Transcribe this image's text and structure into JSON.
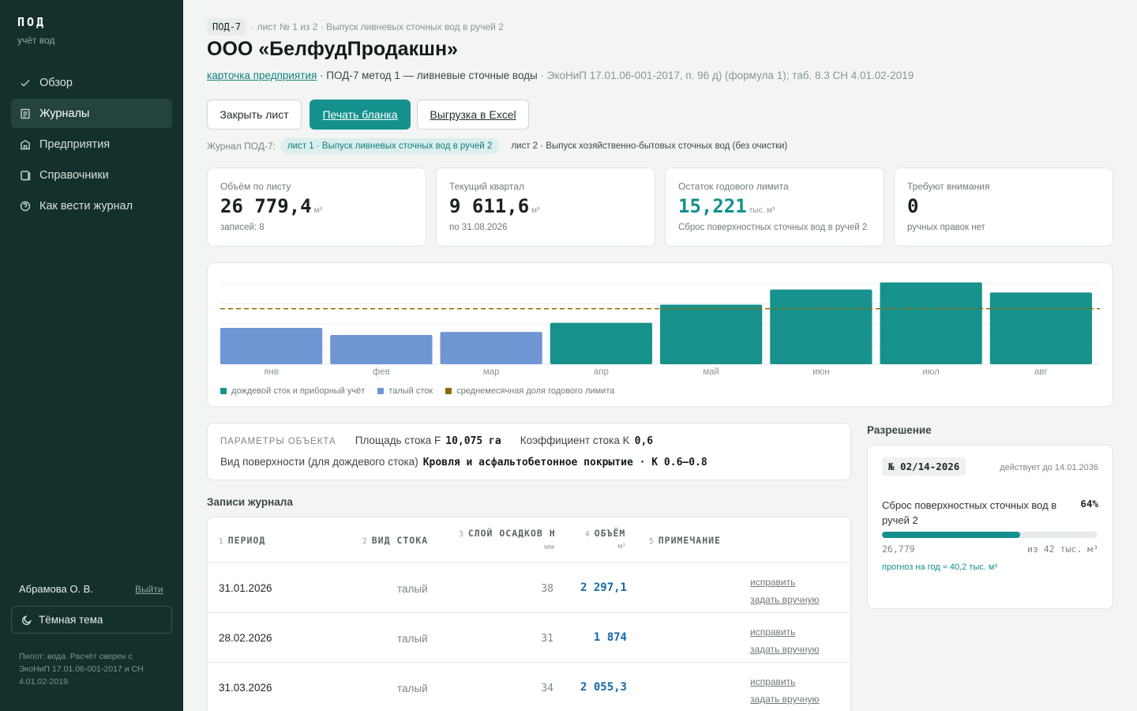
{
  "sidebar": {
    "brand": "ПОД",
    "brand_sub": "учёт вод",
    "nav": [
      {
        "label": "Обзор",
        "icon": "check-icon",
        "active": false
      },
      {
        "label": "Журналы",
        "icon": "journal-icon",
        "active": true
      },
      {
        "label": "Предприятия",
        "icon": "building-icon",
        "active": false
      },
      {
        "label": "Справочники",
        "icon": "book-icon",
        "active": false
      },
      {
        "label": "Как вести журнал",
        "icon": "help-icon",
        "active": false
      }
    ],
    "user": "Абрамова О. В.",
    "logout": "Выйти",
    "theme_toggle": "Тёмная тема",
    "footnote": "Пилот: вода. Расчёт сверен с ЭкоНиП 17.01.06-001-2017 и СН 4.01.02-2019."
  },
  "header": {
    "form_code": "ПОД-7",
    "crumb": "· лист № 1 из 2 · Выпуск ливневых сточных вод в ручей 2",
    "title": "ООО «БелфудПродакшн»",
    "card_link": "карточка предприятия",
    "method": " · ПОД-7 метод 1 — ливневые сточные воды",
    "reference": " · ЭкоНиП 17.01.06-001-2017, п. 96 д) (формула 1); таб. 8.3 СН 4.01.02-2019"
  },
  "actions": {
    "close": "Закрыть лист",
    "print": "Печать бланка",
    "export": "Выгрузка в Excel"
  },
  "sheets": {
    "label": "Журнал ПОД-7:",
    "tabs": [
      {
        "label": "лист 1 · Выпуск ливневых сточных вод в ручей 2",
        "active": true
      },
      {
        "label": "лист 2 · Выпуск хозяйственно-бытовых сточных вод (без очистки)",
        "active": false
      }
    ]
  },
  "stats": [
    {
      "label": "Объём по листу",
      "value": "26 779,4",
      "unit": "м³",
      "sub": "записей: 8",
      "accent": false
    },
    {
      "label": "Текущий квартал",
      "value": "9 611,6",
      "unit": "м³",
      "sub": "по 31.08.2026",
      "accent": false
    },
    {
      "label": "Остаток годового лимита",
      "value": "15,221",
      "unit": "тыс. м³",
      "sub": "Сброс поверхностных сточных вод в ручей 2",
      "accent": true
    },
    {
      "label": "Требуют внимания",
      "value": "0",
      "unit": "",
      "sub": "ручных правок нет",
      "accent": false
    }
  ],
  "chart_data": {
    "type": "bar",
    "categories": [
      "янв",
      "фев",
      "мар",
      "апр",
      "май",
      "июн",
      "июл",
      "авг"
    ],
    "series": [
      {
        "name": "дождевой сток и приборный учёт",
        "values": [
          null,
          null,
          null,
          2.05,
          2.95,
          3.7,
          4.05,
          3.55
        ],
        "color": "#16918c"
      },
      {
        "name": "талый сток",
        "values": [
          1.8,
          1.45,
          1.6,
          null,
          null,
          null,
          null,
          null
        ],
        "color": "#6f95d3"
      }
    ],
    "reference_lines": [
      {
        "name": "среднемесячная доля годового лимита",
        "value": 2.75,
        "color": "#8c6b0a",
        "style": "dashed"
      }
    ],
    "ylim": [
      0,
      4.5
    ],
    "grid": true,
    "legend": "bottom-left"
  },
  "params": {
    "label": "ПАРАМЕТРЫ ОБЪЕКТА",
    "area_label": "Площадь стока F",
    "area_value": "10,075 га",
    "coef_label": "Коэффициент стока K",
    "coef_value": "0,6",
    "surface_label": "Вид поверхности (для дождевого стока)",
    "surface_value": "Кровля и асфальтобетонное покрытие · K 0.6–0.8"
  },
  "journal": {
    "title": "Записи журнала",
    "columns": [
      {
        "n": "1",
        "label": "ПЕРИОД",
        "sub": ""
      },
      {
        "n": "2",
        "label": "ВИД СТОКА",
        "sub": ""
      },
      {
        "n": "3",
        "label": "СЛОЙ ОСАДКОВ H",
        "sub": "мм"
      },
      {
        "n": "4",
        "label": "ОБЪЁМ",
        "sub": "м³"
      },
      {
        "n": "5",
        "label": "ПРИМЕЧАНИЕ",
        "sub": ""
      }
    ],
    "rows": [
      {
        "period": "31.01.2026",
        "type": "талый",
        "mm": "38",
        "volume": "2 297,1",
        "fix": "исправить",
        "manual": "задать вручную"
      },
      {
        "period": "28.02.2026",
        "type": "талый",
        "mm": "31",
        "volume": "1 874",
        "fix": "исправить",
        "manual": "задать вручную"
      },
      {
        "period": "31.03.2026",
        "type": "талый",
        "mm": "34",
        "volume": "2 055,3",
        "fix": "исправить",
        "manual": "задать вручную"
      }
    ]
  },
  "permit": {
    "title": "Разрешение",
    "number": "№ 02/14-2026",
    "valid_until": "действует до 14.01.2036",
    "description": "Сброс поверхностных сточных вод в ручей 2",
    "percent": "64%",
    "fraction": 0.64,
    "used": "26,779",
    "total": "из 42 тыс. м³",
    "forecast": "прогноз на год ≈ 40,2 тыс. м³"
  }
}
